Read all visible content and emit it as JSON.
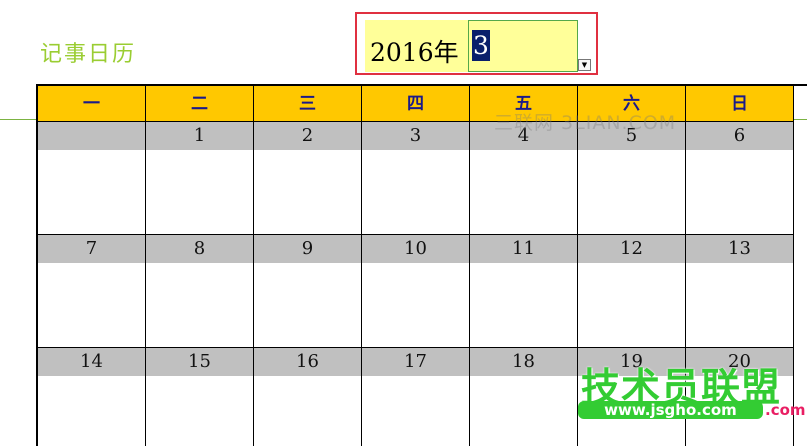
{
  "header": {
    "title": "记事日历"
  },
  "picker": {
    "year_label": "2016年",
    "month_value": "3"
  },
  "calendar": {
    "weekdays": [
      "一",
      "二",
      "三",
      "四",
      "五",
      "六",
      "日"
    ],
    "weeks": [
      [
        "",
        "1",
        "2",
        "3",
        "4",
        "5",
        "6"
      ],
      [
        "7",
        "8",
        "9",
        "10",
        "11",
        "12",
        "13"
      ],
      [
        "14",
        "15",
        "16",
        "17",
        "18",
        "19",
        "20"
      ]
    ]
  },
  "watermark": {
    "text": "三联网 3LIAN.COM"
  },
  "logo": {
    "main": "技术员联盟",
    "url": "www.jsgho.com",
    "tld": ".com"
  },
  "colors": {
    "title": "#9ACD32",
    "header_fill": "#FFC800",
    "date_band": "#C0C0C0",
    "input_fill": "#FFFF99",
    "frame": "#E03040"
  }
}
